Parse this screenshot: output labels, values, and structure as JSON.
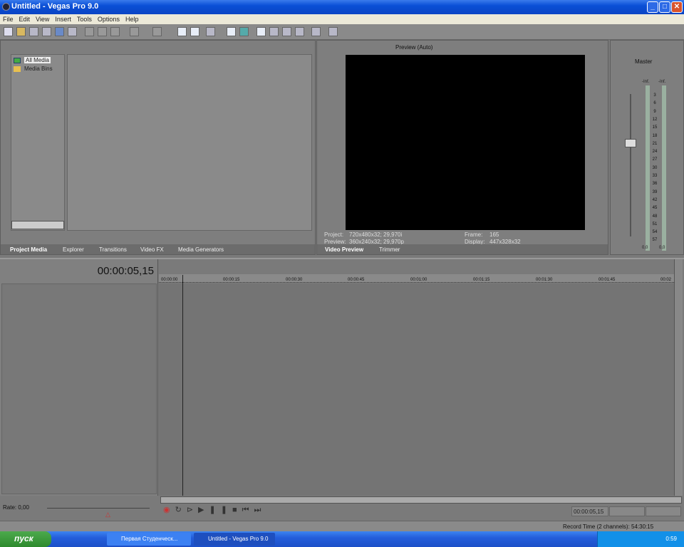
{
  "window": {
    "title": "Untitled - Vegas Pro 9.0"
  },
  "menu": [
    "File",
    "Edit",
    "View",
    "Insert",
    "Tools",
    "Options",
    "Help"
  ],
  "media_tree": [
    "All Media",
    "Media Bins"
  ],
  "left_tabs": [
    "Project Media",
    "Explorer",
    "Transitions",
    "Video FX",
    "Media Generators"
  ],
  "preview": {
    "mode": "Preview (Auto)",
    "project_label": "Project:",
    "project": "720x480x32; 29,970i",
    "preview_label": "Preview:",
    "preview": "360x240x32; 29,970p",
    "frame_label": "Frame:",
    "frame": "165",
    "display_label": "Display:",
    "display": "447x328x32"
  },
  "preview_tabs": [
    "Video Preview",
    "Trimmer"
  ],
  "master": {
    "title": "Master",
    "peak_left": "-Inf.",
    "peak_right": "-Inf.",
    "scale": [
      "3",
      "6",
      "9",
      "12",
      "15",
      "18",
      "21",
      "24",
      "27",
      "30",
      "33",
      "36",
      "39",
      "42",
      "45",
      "48",
      "51",
      "54",
      "57"
    ],
    "value_left": "0,0",
    "value_right": "0,0"
  },
  "timeline": {
    "timecode": "00:00:05,15",
    "ruler": [
      "00:00:00",
      "00:00:15",
      "00:00:30",
      "00:00:45",
      "00:01:00",
      "00:01:15",
      "00:01:30",
      "00:01:45",
      "00:02"
    ],
    "rate": "Rate: 0,00",
    "cursor_time": "00:00:05,15",
    "record_time": "Record Time (2 channels): 54:30:15"
  },
  "taskbar": {
    "start": "пуск",
    "tasks": [
      "Первая Студенческ...",
      "Untitled - Vegas Pro 9.0"
    ],
    "clock": "0:59"
  }
}
